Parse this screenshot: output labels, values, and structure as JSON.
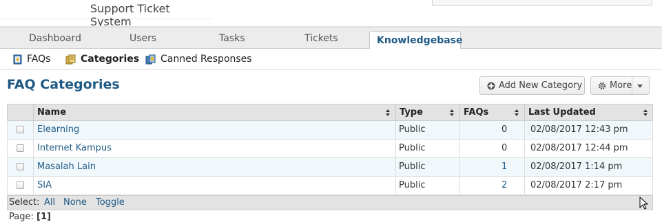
{
  "header": {
    "system_name": "Support Ticket System"
  },
  "nav": {
    "tabs": [
      {
        "label": "Dashboard"
      },
      {
        "label": "Users"
      },
      {
        "label": "Tasks"
      },
      {
        "label": "Tickets"
      },
      {
        "label": "Knowledgebase"
      }
    ],
    "active_tab": "Knowledgebase"
  },
  "subnav": {
    "items": [
      {
        "label": "FAQs",
        "icon": "faq-book-icon"
      },
      {
        "label": "Categories",
        "icon": "categories-icon"
      },
      {
        "label": "Canned Responses",
        "icon": "canned-responses-icon"
      }
    ],
    "active": "Categories"
  },
  "page": {
    "title": "FAQ Categories",
    "add_button": "Add New Category",
    "more_button": "More"
  },
  "table": {
    "columns": [
      "Name",
      "Type",
      "FAQs",
      "Last Updated"
    ],
    "rows": [
      {
        "name": "Elearning",
        "type": "Public",
        "faqs": "0",
        "updated": "02/08/2017 12:43 pm"
      },
      {
        "name": "Internet Kampus",
        "type": "Public",
        "faqs": "0",
        "updated": "02/08/2017 12:44 pm"
      },
      {
        "name": "Masalah Lain",
        "type": "Public",
        "faqs": "1",
        "updated": "02/08/2017 1:14 pm"
      },
      {
        "name": "SIA",
        "type": "Public",
        "faqs": "2",
        "updated": "02/08/2017 2:17 pm"
      }
    ]
  },
  "select_bar": {
    "label": "Select:",
    "all": "All",
    "none": "None",
    "toggle": "Toggle"
  },
  "pagination": {
    "label": "Page:",
    "current": "[1]"
  },
  "colors": {
    "accent": "#1f5a85",
    "row_alt": "#f0f8fc",
    "header_bg": "#e3e3e3"
  }
}
